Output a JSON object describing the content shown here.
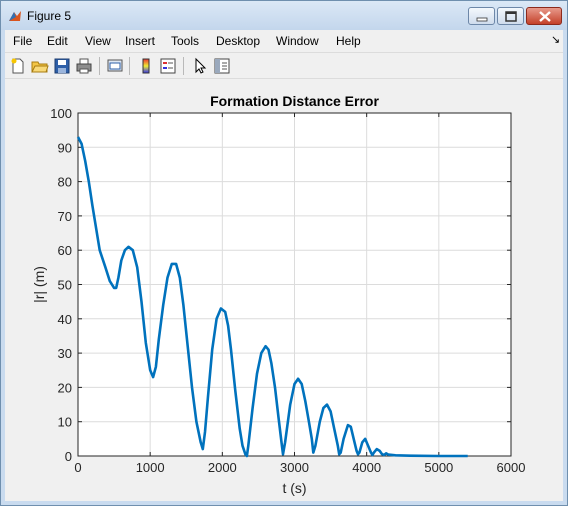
{
  "window": {
    "title": "Figure 5"
  },
  "menu": {
    "items": [
      "File",
      "Edit",
      "View",
      "Insert",
      "Tools",
      "Desktop",
      "Window",
      "Help"
    ]
  },
  "toolbar": {
    "icons": [
      "new-figure-icon",
      "open-file-icon",
      "save-icon",
      "print-icon",
      "link-plot-icon",
      "colorbar-icon",
      "legend-icon",
      "pointer-icon",
      "property-editor-icon"
    ]
  },
  "chart_data": {
    "type": "line",
    "title": "Formation Distance Error",
    "xlabel": "t (s)",
    "ylabel": "|r| (m)",
    "xlim": [
      0,
      6000
    ],
    "ylim": [
      0,
      100
    ],
    "xticks": [
      "0",
      "1000",
      "2000",
      "3000",
      "4000",
      "5000",
      "6000"
    ],
    "yticks": [
      "0",
      "10",
      "20",
      "30",
      "40",
      "50",
      "60",
      "70",
      "80",
      "90",
      "100"
    ],
    "grid": true,
    "line_color": "#0072bd",
    "series": [
      {
        "name": "",
        "x": [
          0,
          50,
          100,
          150,
          200,
          300,
          380,
          440,
          500,
          530,
          560,
          600,
          650,
          700,
          760,
          820,
          880,
          940,
          1000,
          1040,
          1080,
          1120,
          1180,
          1240,
          1300,
          1360,
          1410,
          1460,
          1520,
          1580,
          1640,
          1700,
          1730,
          1760,
          1800,
          1860,
          1920,
          1980,
          2040,
          2080,
          2120,
          2180,
          2240,
          2280,
          2320,
          2340,
          2360,
          2420,
          2480,
          2540,
          2600,
          2640,
          2680,
          2730,
          2780,
          2820,
          2840,
          2870,
          2940,
          3000,
          3050,
          3100,
          3150,
          3200,
          3240,
          3260,
          3290,
          3350,
          3400,
          3450,
          3500,
          3550,
          3600,
          3620,
          3640,
          3680,
          3740,
          3780,
          3820,
          3860,
          3880,
          3900,
          3940,
          3980,
          4020,
          4060,
          4080,
          4100,
          4140,
          4180,
          4210,
          4240,
          4270,
          4300,
          4400,
          4600,
          5000,
          5400
        ],
        "y": [
          93,
          91,
          86,
          80,
          73,
          60,
          55,
          51,
          49,
          49,
          52,
          57,
          60,
          61,
          60,
          55,
          45,
          33,
          25,
          23,
          26,
          34,
          44,
          52,
          56,
          56,
          52,
          44,
          32,
          20,
          10,
          4,
          2,
          7,
          17,
          31,
          40,
          43,
          42,
          38,
          31,
          19,
          8,
          3,
          0.5,
          0,
          3,
          14,
          24,
          30,
          32,
          31,
          27,
          20,
          11,
          4,
          0.5,
          4,
          15,
          21,
          22.5,
          21,
          16,
          10,
          5,
          1,
          3,
          10,
          14,
          15,
          13,
          8,
          3,
          0.5,
          1,
          5,
          9,
          8.5,
          5,
          1.5,
          0.5,
          1,
          4,
          5,
          3,
          1,
          0.3,
          1,
          2,
          1.5,
          0.6,
          0.3,
          0.8,
          0.4,
          0.2,
          0.1,
          0,
          0
        ]
      }
    ]
  }
}
